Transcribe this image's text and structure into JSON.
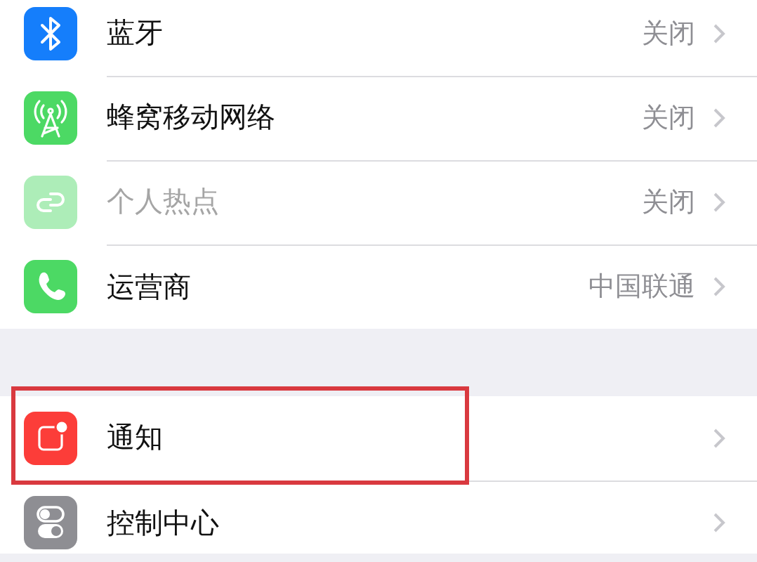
{
  "groups": [
    {
      "rows": [
        {
          "kind": "bluetooth",
          "label": "蓝牙",
          "value": "关闭",
          "disabled": false,
          "highlighted": false
        },
        {
          "kind": "cellular",
          "label": "蜂窝移动网络",
          "value": "关闭",
          "disabled": false,
          "highlighted": false
        },
        {
          "kind": "hotspot",
          "label": "个人热点",
          "value": "关闭",
          "disabled": true,
          "highlighted": false
        },
        {
          "kind": "carrier",
          "label": "运营商",
          "value": "中国联通",
          "disabled": false,
          "highlighted": false
        }
      ]
    },
    {
      "rows": [
        {
          "kind": "notifications",
          "label": "通知",
          "disabled": false,
          "highlighted": true
        },
        {
          "kind": "control",
          "label": "控制中心",
          "disabled": false,
          "highlighted": false
        }
      ]
    }
  ]
}
